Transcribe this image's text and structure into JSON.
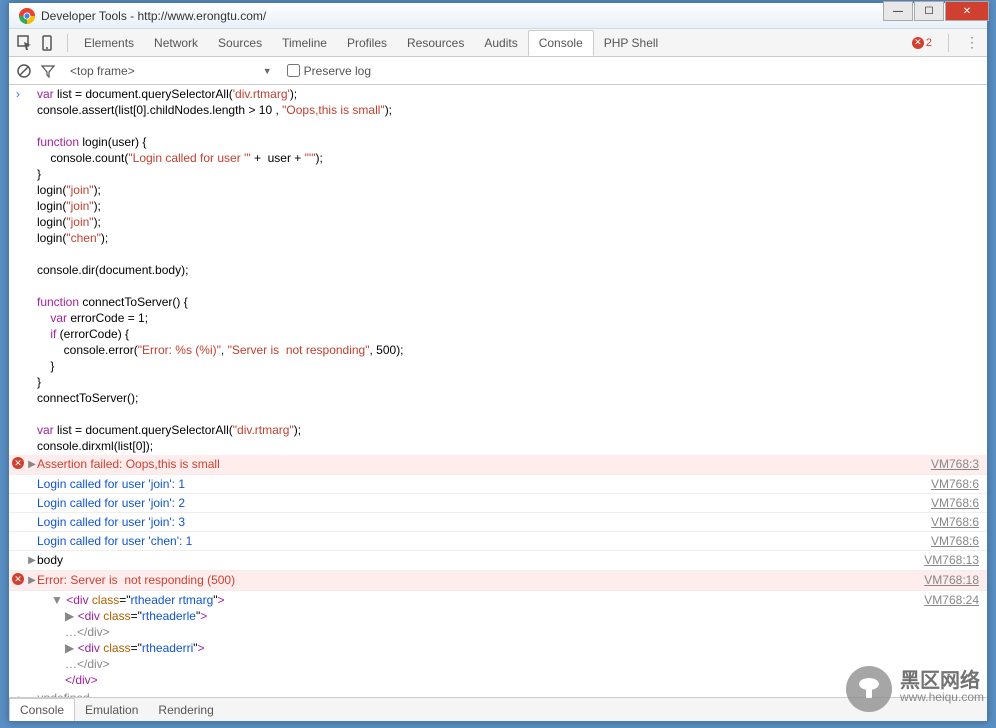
{
  "window": {
    "title": "Developer Tools - http://www.erongtu.com/"
  },
  "toolbar": {
    "tabs": [
      "Elements",
      "Network",
      "Sources",
      "Timeline",
      "Profiles",
      "Resources",
      "Audits",
      "Console",
      "PHP Shell"
    ],
    "active_tab": "Console",
    "error_count": "2"
  },
  "filter": {
    "frame": "<top frame>",
    "preserve_label": "Preserve log"
  },
  "code_lines": [
    {
      "t": "var",
      "rest": " list = document.querySelectorAll(",
      "s": "'div.rtmarg'",
      "tail": ");"
    },
    {
      "plain": "console.assert(list[0].childNodes.length > 10 , ",
      "s": "\"Oops,this is small\"",
      "tail": ");"
    },
    {
      "blank": true
    },
    {
      "t": "function",
      "rest": " login(user) {"
    },
    {
      "indent": "    console.count(",
      "s": "\"Login called for user '\"",
      "mid": " +  user + ",
      "s2": "\"'\"",
      "tail": ");"
    },
    {
      "plain": "}"
    },
    {
      "plain": "login(",
      "s": "\"join\"",
      "tail": ");"
    },
    {
      "plain": "login(",
      "s": "\"join\"",
      "tail": ");"
    },
    {
      "plain": "login(",
      "s": "\"join\"",
      "tail": ");"
    },
    {
      "plain": "login(",
      "s": "\"chen\"",
      "tail": ");"
    },
    {
      "blank": true
    },
    {
      "plain": "console.dir(document.body);"
    },
    {
      "blank": true
    },
    {
      "t": "function",
      "rest": " connectToServer() {"
    },
    {
      "indent": "    ",
      "t": "var",
      "rest": " errorCode = 1;"
    },
    {
      "indent": "    ",
      "t": "if",
      "rest": " (errorCode) {"
    },
    {
      "indent": "        console.error(",
      "s": "\"Error: %s (%i)\"",
      "mid": ", ",
      "s2": "\"Server is  not responding\"",
      "tail": ", 500);"
    },
    {
      "indent": "    }",
      "plain": ""
    },
    {
      "plain": "}"
    },
    {
      "plain": "connectToServer();"
    },
    {
      "blank": true
    },
    {
      "t": "var",
      "rest": " list = document.querySelectorAll(",
      "s": "\"div.rtmarg\"",
      "tail": ");"
    },
    {
      "plain": "console.dirxml(list[0]);"
    }
  ],
  "output": [
    {
      "type": "error",
      "exp": true,
      "text": "Assertion failed: Oops,this is small",
      "src": "VM768:3"
    },
    {
      "type": "log",
      "text": "Login called for user 'join': 1",
      "src": "VM768:6"
    },
    {
      "type": "log",
      "text": "Login called for user 'join': 2",
      "src": "VM768:6"
    },
    {
      "type": "log",
      "text": "Login called for user 'join': 3",
      "src": "VM768:6"
    },
    {
      "type": "log",
      "text": "Login called for user 'chen': 1",
      "src": "VM768:6"
    },
    {
      "type": "obj",
      "exp": true,
      "text": "body",
      "src": "VM768:13"
    },
    {
      "type": "error",
      "exp": true,
      "text": "Error: Server is  not responding (500)",
      "src": "VM768:18"
    }
  ],
  "dirxml": {
    "src": "VM768:24",
    "lines": [
      {
        "lvl": 1,
        "open": "▼",
        "tag": "div",
        "cls": "rtheader rtmarg"
      },
      {
        "lvl": 2,
        "open": "▶",
        "tag": "div",
        "cls": "rtheaderle"
      },
      {
        "lvl": 2,
        "ell": "…</div>"
      },
      {
        "lvl": 2,
        "open": "▶",
        "tag": "div",
        "cls": "rtheaderri"
      },
      {
        "lvl": 2,
        "ell": "…</div>"
      },
      {
        "lvl": 2,
        "close": "</div>"
      }
    ]
  },
  "return_val": "undefined",
  "bottom_tabs": [
    "Console",
    "Emulation",
    "Rendering"
  ],
  "watermark": {
    "big": "黑区网络",
    "url": "www.heiqu.com"
  }
}
